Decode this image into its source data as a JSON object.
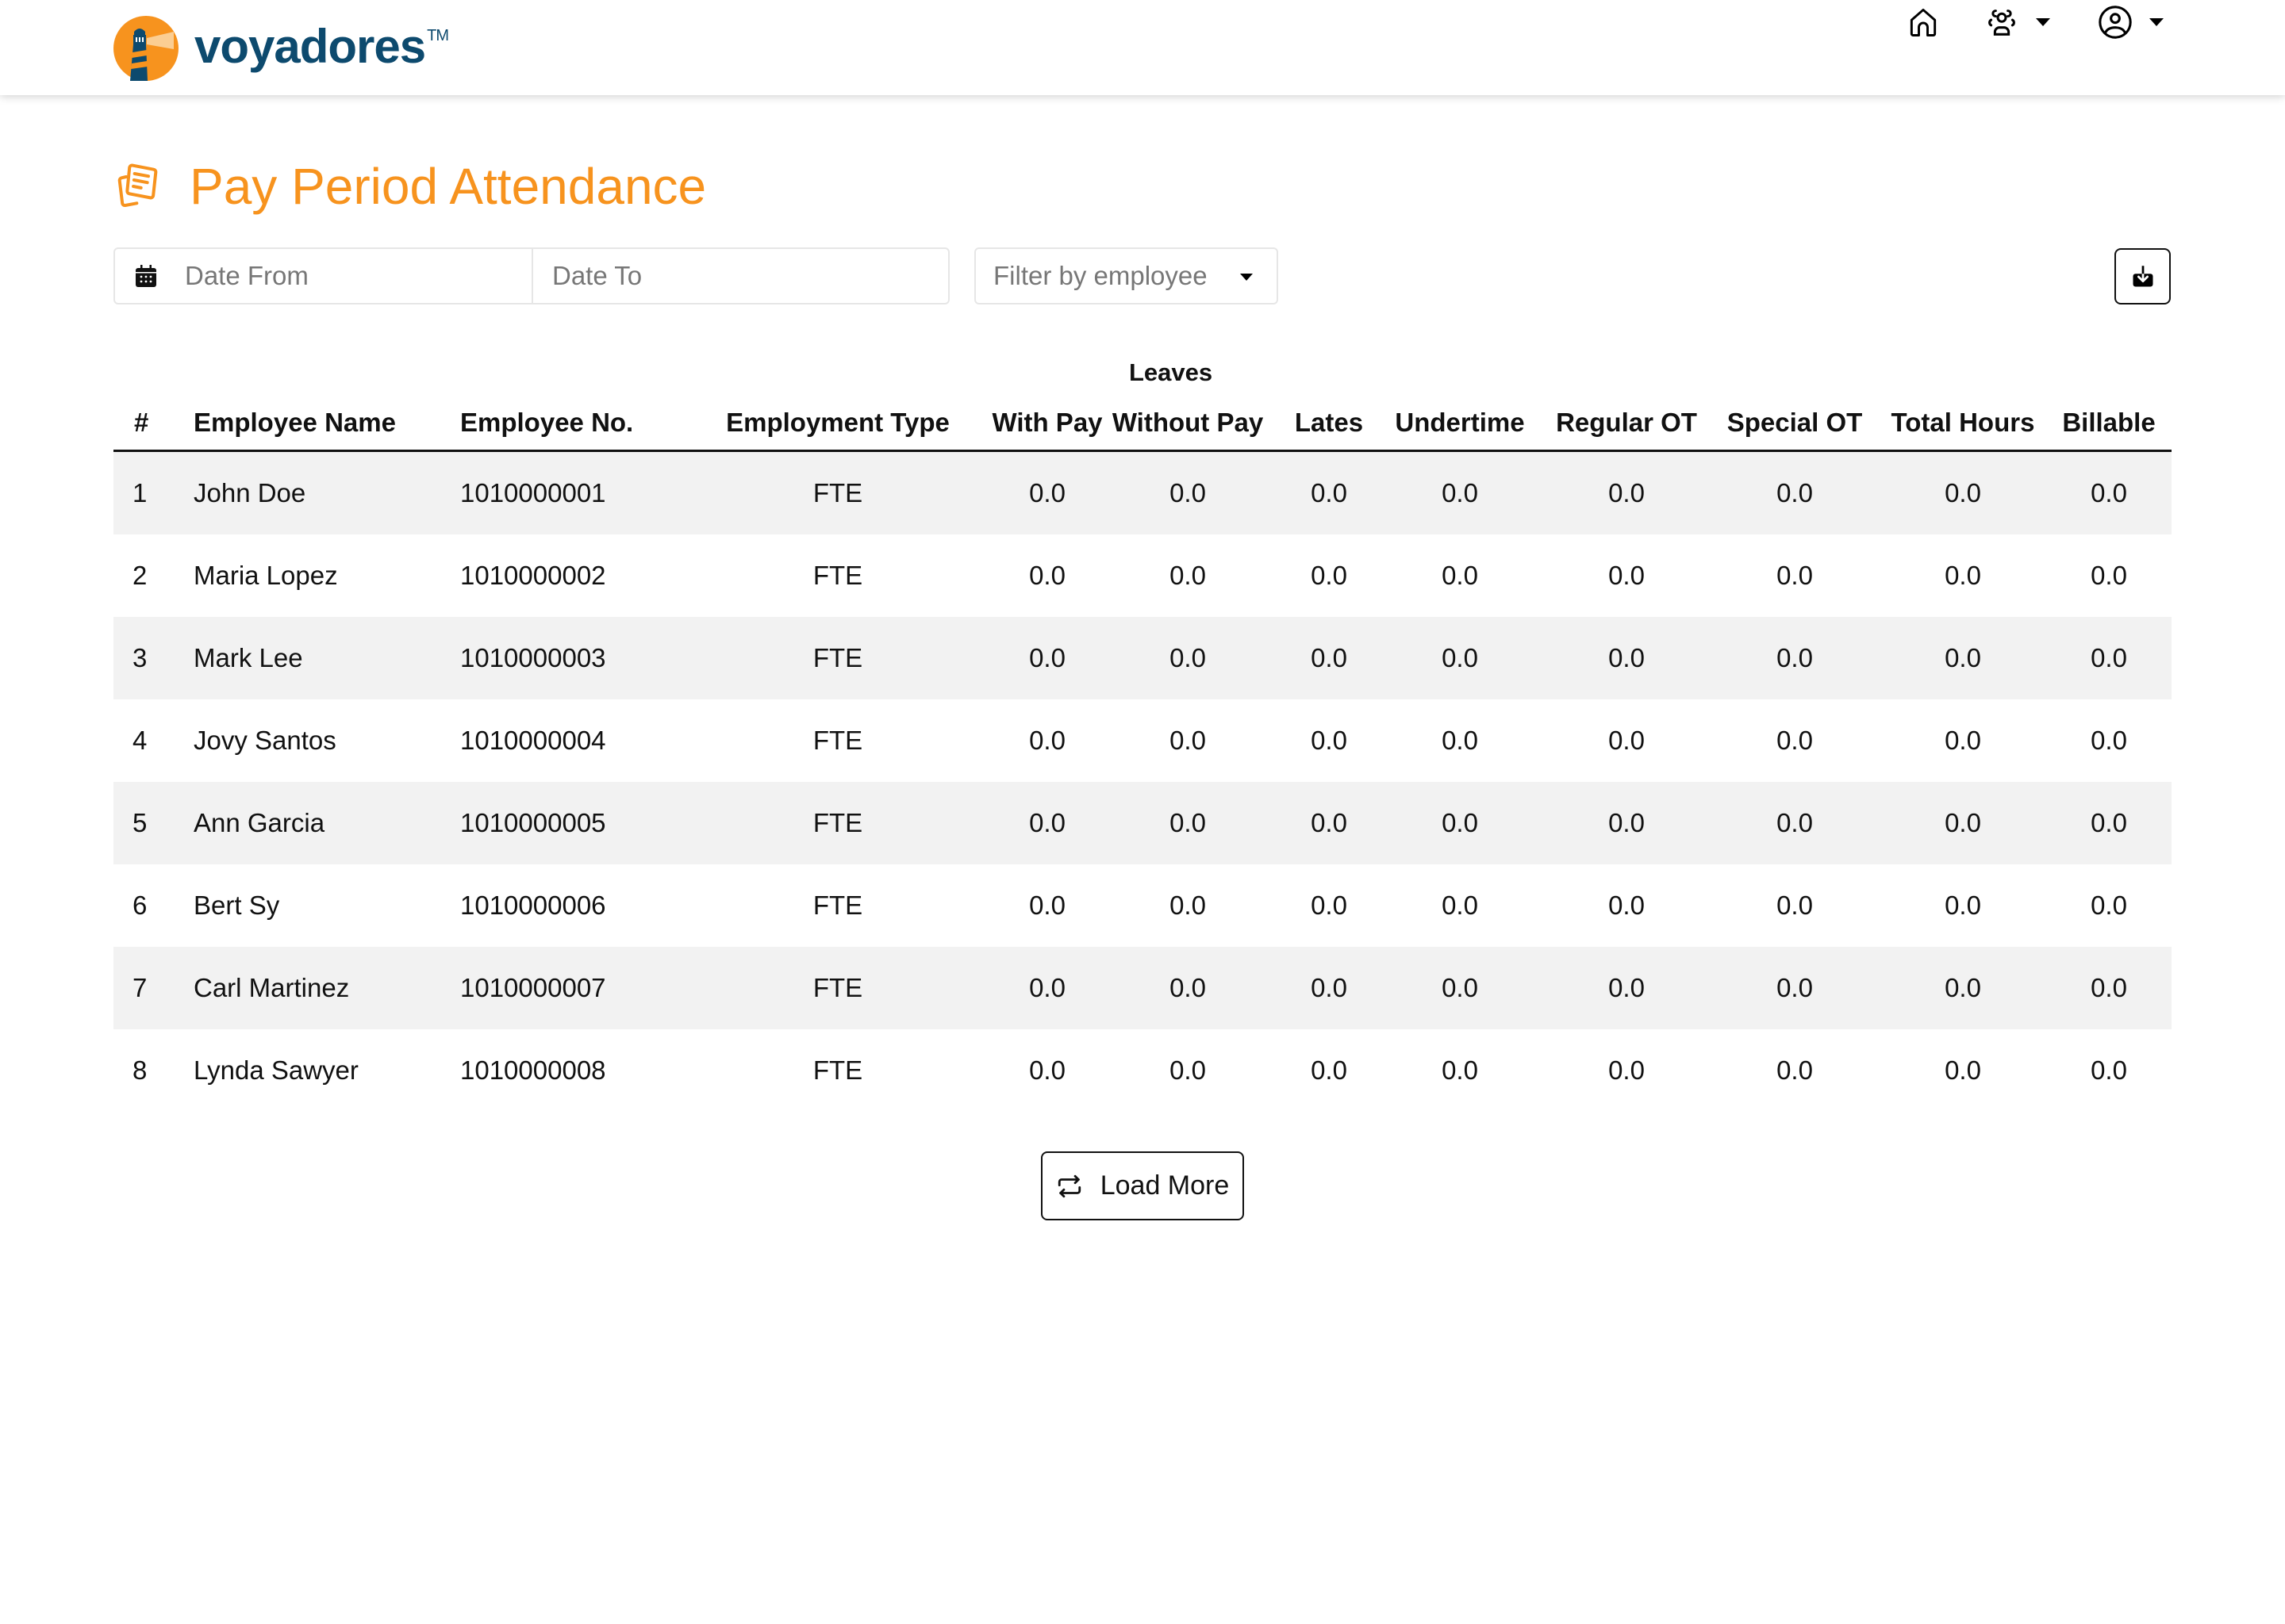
{
  "brand": {
    "name": "voyadores",
    "trademark": "TM",
    "colors": {
      "primary_orange": "#f7931e",
      "navy": "#0d4a6e"
    }
  },
  "header": {
    "nav": [
      {
        "icon": "home-icon",
        "label": "Home"
      },
      {
        "icon": "team-icon",
        "label": "Team",
        "has_dropdown": true
      },
      {
        "icon": "user-account-icon",
        "label": "Account",
        "has_dropdown": true
      }
    ]
  },
  "page": {
    "title": "Pay Period Attendance",
    "title_icon": "documents-icon"
  },
  "filters": {
    "date_from": {
      "placeholder": "Date From",
      "value": ""
    },
    "date_to": {
      "placeholder": "Date To",
      "value": ""
    },
    "employee_filter": {
      "placeholder": "Filter by employee",
      "value": ""
    },
    "download_label": "Download"
  },
  "table": {
    "group_header": "Leaves",
    "columns": [
      "#",
      "Employee Name",
      "Employee No.",
      "Employment Type",
      "With Pay",
      "Without Pay",
      "Lates",
      "Undertime",
      "Regular OT",
      "Special OT",
      "Total Hours",
      "Billable"
    ],
    "rows": [
      {
        "index": "1",
        "name": "John Doe",
        "employee_no": "1010000001",
        "type": "FTE",
        "with_pay": "0.0",
        "without_pay": "0.0",
        "lates": "0.0",
        "undertime": "0.0",
        "regular_ot": "0.0",
        "special_ot": "0.0",
        "total_hours": "0.0",
        "billable": "0.0"
      },
      {
        "index": "2",
        "name": "Maria Lopez",
        "employee_no": "1010000002",
        "type": "FTE",
        "with_pay": "0.0",
        "without_pay": "0.0",
        "lates": "0.0",
        "undertime": "0.0",
        "regular_ot": "0.0",
        "special_ot": "0.0",
        "total_hours": "0.0",
        "billable": "0.0"
      },
      {
        "index": "3",
        "name": "Mark Lee",
        "employee_no": "1010000003",
        "type": "FTE",
        "with_pay": "0.0",
        "without_pay": "0.0",
        "lates": "0.0",
        "undertime": "0.0",
        "regular_ot": "0.0",
        "special_ot": "0.0",
        "total_hours": "0.0",
        "billable": "0.0"
      },
      {
        "index": "4",
        "name": "Jovy Santos",
        "employee_no": "1010000004",
        "type": "FTE",
        "with_pay": "0.0",
        "without_pay": "0.0",
        "lates": "0.0",
        "undertime": "0.0",
        "regular_ot": "0.0",
        "special_ot": "0.0",
        "total_hours": "0.0",
        "billable": "0.0"
      },
      {
        "index": "5",
        "name": "Ann Garcia",
        "employee_no": "1010000005",
        "type": "FTE",
        "with_pay": "0.0",
        "without_pay": "0.0",
        "lates": "0.0",
        "undertime": "0.0",
        "regular_ot": "0.0",
        "special_ot": "0.0",
        "total_hours": "0.0",
        "billable": "0.0"
      },
      {
        "index": "6",
        "name": "Bert Sy",
        "employee_no": "1010000006",
        "type": "FTE",
        "with_pay": "0.0",
        "without_pay": "0.0",
        "lates": "0.0",
        "undertime": "0.0",
        "regular_ot": "0.0",
        "special_ot": "0.0",
        "total_hours": "0.0",
        "billable": "0.0"
      },
      {
        "index": "7",
        "name": "Carl Martinez",
        "employee_no": "1010000007",
        "type": "FTE",
        "with_pay": "0.0",
        "without_pay": "0.0",
        "lates": "0.0",
        "undertime": "0.0",
        "regular_ot": "0.0",
        "special_ot": "0.0",
        "total_hours": "0.0",
        "billable": "0.0"
      },
      {
        "index": "8",
        "name": "Lynda Sawyer",
        "employee_no": "1010000008",
        "type": "FTE",
        "with_pay": "0.0",
        "without_pay": "0.0",
        "lates": "0.0",
        "undertime": "0.0",
        "regular_ot": "0.0",
        "special_ot": "0.0",
        "total_hours": "0.0",
        "billable": "0.0"
      }
    ]
  },
  "load_more": {
    "label": "Load More",
    "icon": "repeat-icon"
  }
}
